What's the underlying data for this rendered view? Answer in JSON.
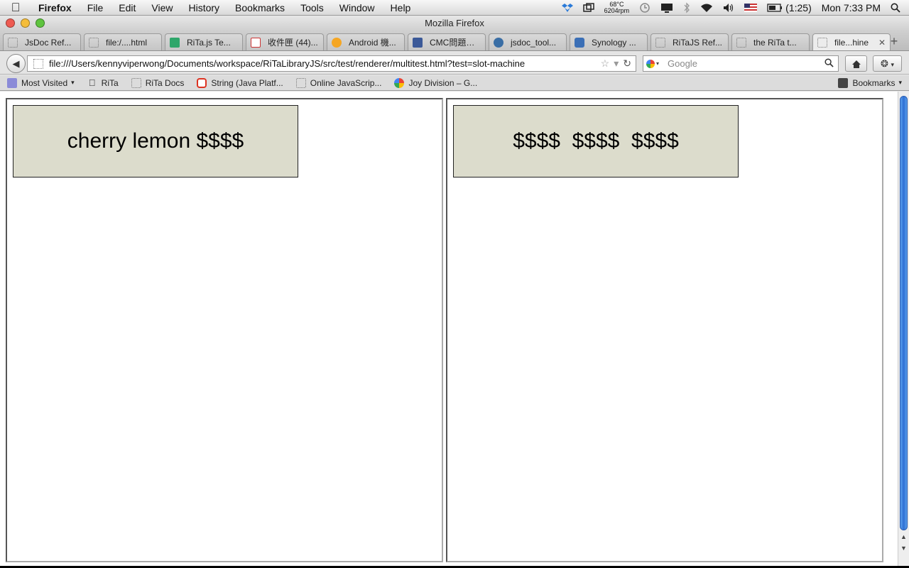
{
  "menubar": {
    "apple_icon": "apple-icon",
    "app_name": "Firefox",
    "items": [
      "File",
      "Edit",
      "View",
      "History",
      "Bookmarks",
      "Tools",
      "Window",
      "Help"
    ],
    "temperature": "68°C",
    "fan": "6204rpm",
    "battery": "(1:25)",
    "clock": "Mon 7:33 PM"
  },
  "window": {
    "title": "Mozilla Firefox"
  },
  "tabs": [
    {
      "label": "JsDoc Ref...",
      "icon": "page-icon"
    },
    {
      "label": "file:/....html",
      "icon": "page-icon"
    },
    {
      "label": "RiTa.js Te...",
      "icon": "spreadsheet-icon"
    },
    {
      "label": "收件匣 (44)...",
      "icon": "gmail-icon"
    },
    {
      "label": "Android 機...",
      "icon": "chat-icon"
    },
    {
      "label": "CMC問題天...",
      "icon": "facebook-icon"
    },
    {
      "label": "jsdoc_tool...",
      "icon": "project-icon"
    },
    {
      "label": "Synology ...",
      "icon": "dsm-icon"
    },
    {
      "label": "RiTaJS Ref...",
      "icon": "page-icon"
    },
    {
      "label": "the RiTa t...",
      "icon": "page-icon"
    },
    {
      "label": "file...hine",
      "icon": "page-icon",
      "active": true
    }
  ],
  "navbar": {
    "url": "file:///Users/kennyviperwong/Documents/workspace/RiTaLibraryJS/src/test/renderer/multitest.html?test=slot-machine",
    "search_placeholder": "Google"
  },
  "bookmarks": {
    "items": [
      {
        "label": "Most Visited",
        "icon": "most-visited-icon"
      },
      {
        "label": "RiTa",
        "icon": "apple-icon"
      },
      {
        "label": "RiTa Docs",
        "icon": "page-icon"
      },
      {
        "label": "String (Java Platf...",
        "icon": "oracle-icon"
      },
      {
        "label": "Online JavaScrip...",
        "icon": "page-icon"
      },
      {
        "label": "Joy Division – G...",
        "icon": "google-icon"
      }
    ],
    "menu_label": "Bookmarks"
  },
  "content": {
    "left_slot": "cherry lemon $$$$",
    "right_slot": "$$$$  $$$$  $$$$"
  },
  "colors": {
    "slot_bg": "#dcdccc",
    "scroll_thumb": "#2f6fd3"
  }
}
